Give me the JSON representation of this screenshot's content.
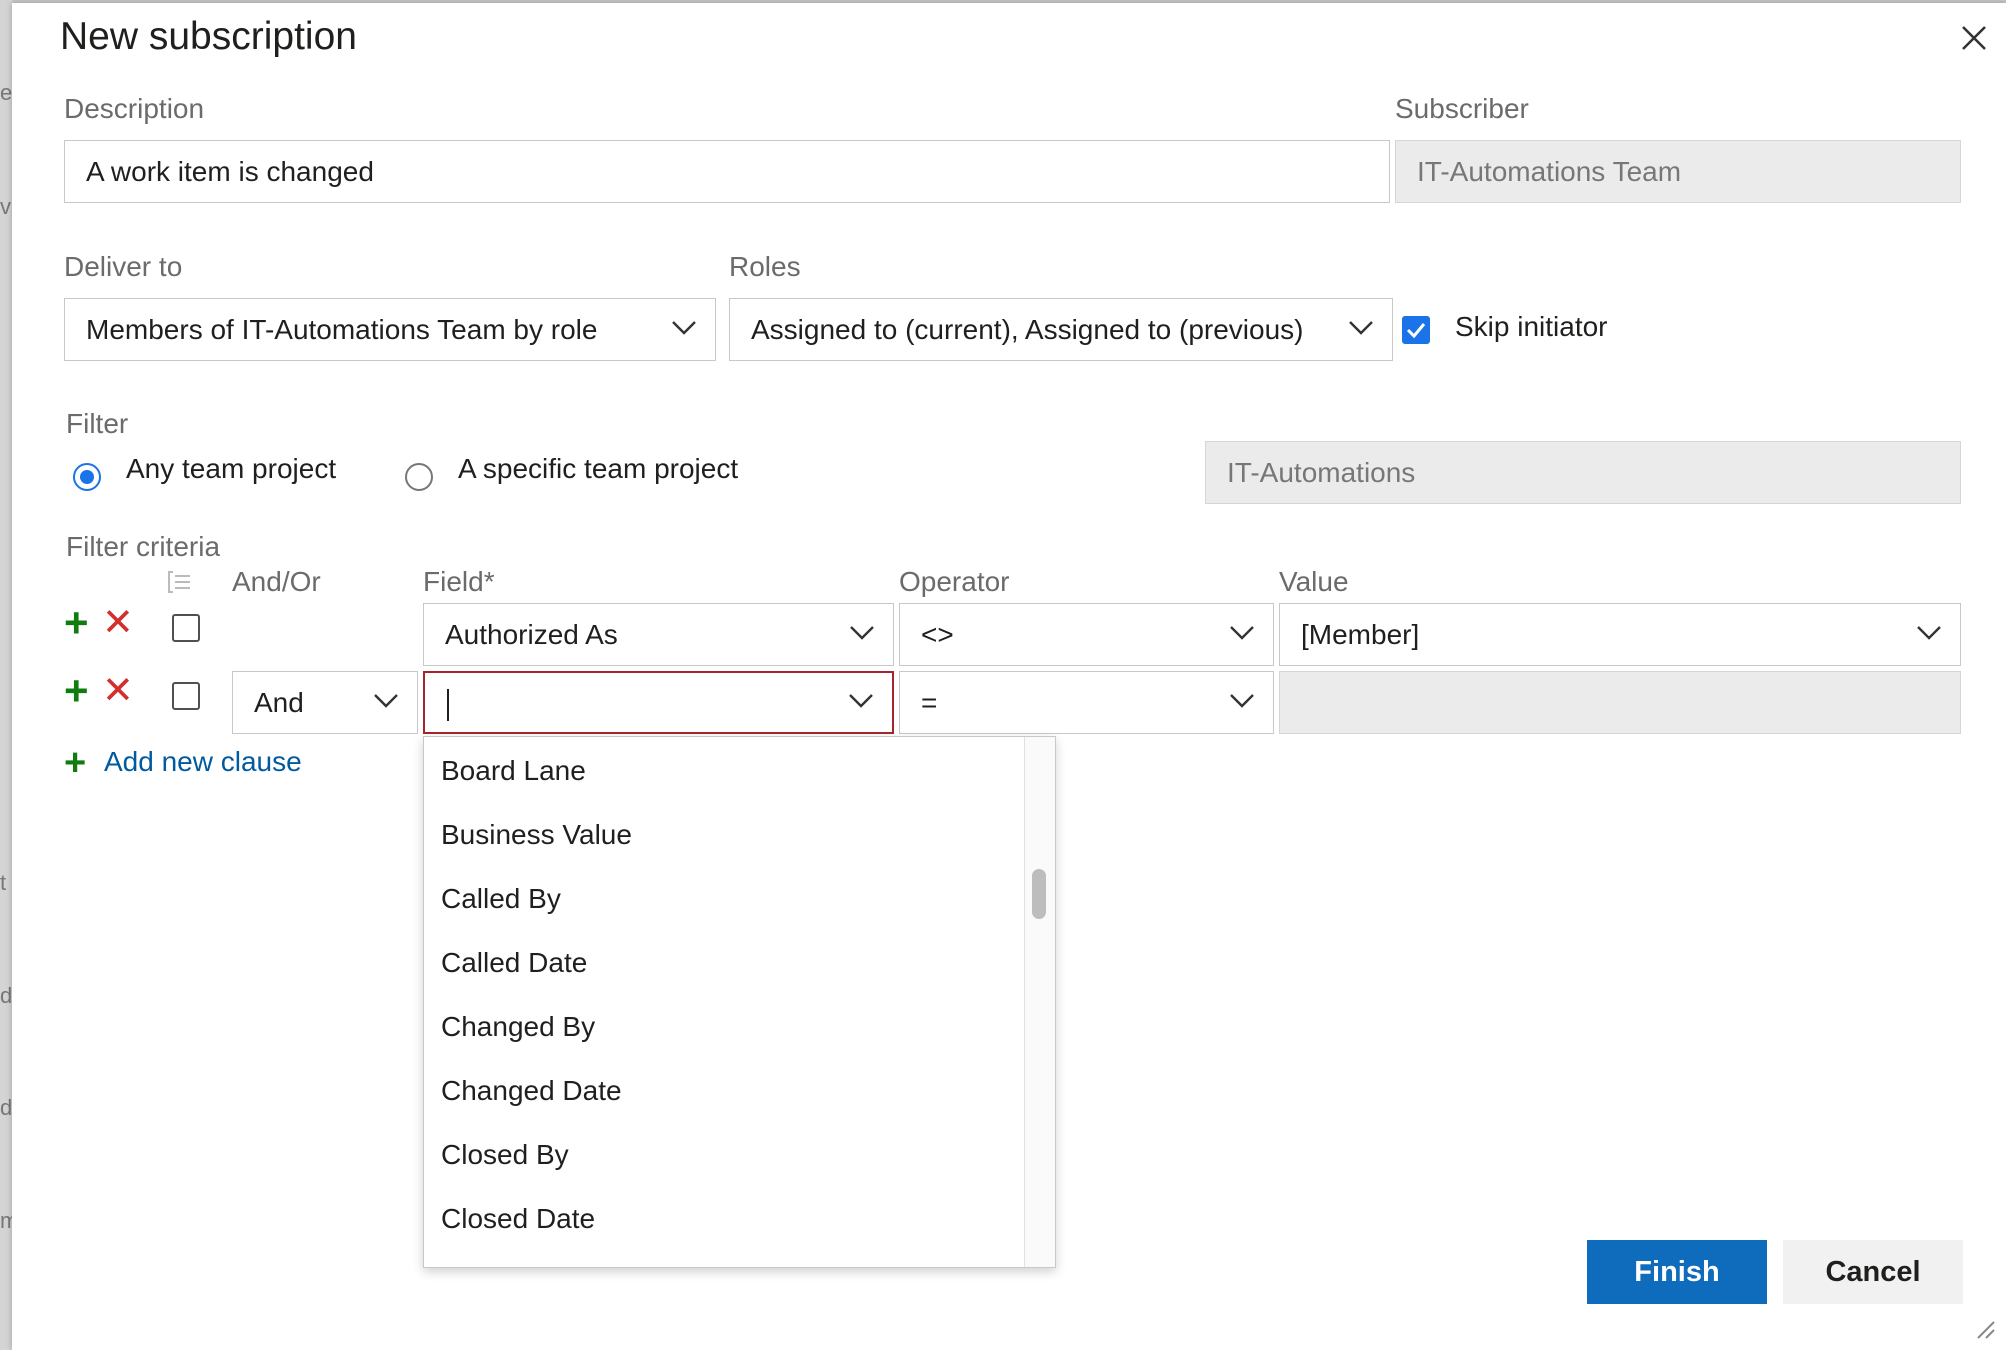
{
  "backdrop": {
    "fragments": [
      "es",
      "v",
      "t",
      "d",
      "d",
      "m"
    ]
  },
  "dialog": {
    "title": "New subscription",
    "close_icon": "close-icon",
    "description": {
      "label": "Description",
      "value": "A work item is changed"
    },
    "subscriber": {
      "label": "Subscriber",
      "value": "IT-Automations Team"
    },
    "deliver_to": {
      "label": "Deliver to",
      "value": "Members of IT-Automations Team by role"
    },
    "roles": {
      "label": "Roles",
      "value": "Assigned to (current), Assigned to (previous)"
    },
    "skip_initiator": {
      "label": "Skip initiator",
      "checked": true
    },
    "filter": {
      "label": "Filter",
      "options": [
        {
          "label": "Any team project",
          "selected": true
        },
        {
          "label": "A specific team project",
          "selected": false
        }
      ],
      "project_value": "IT-Automations"
    },
    "criteria": {
      "label": "Filter criteria",
      "columns": {
        "andor": "And/Or",
        "field": "Field*",
        "operator": "Operator",
        "value": "Value"
      },
      "rows": [
        {
          "andor": "",
          "field": "Authorized As",
          "operator": "<>",
          "value": "[Member]"
        },
        {
          "andor": "And",
          "field": "",
          "operator": "=",
          "value": ""
        }
      ],
      "add_clause": "Add new clause"
    },
    "field_dropdown": {
      "items": [
        "Board Lane",
        "Business Value",
        "Called By",
        "Called Date",
        "Changed By",
        "Changed Date",
        "Closed By",
        "Closed Date"
      ]
    },
    "buttons": {
      "finish": "Finish",
      "cancel": "Cancel"
    }
  }
}
